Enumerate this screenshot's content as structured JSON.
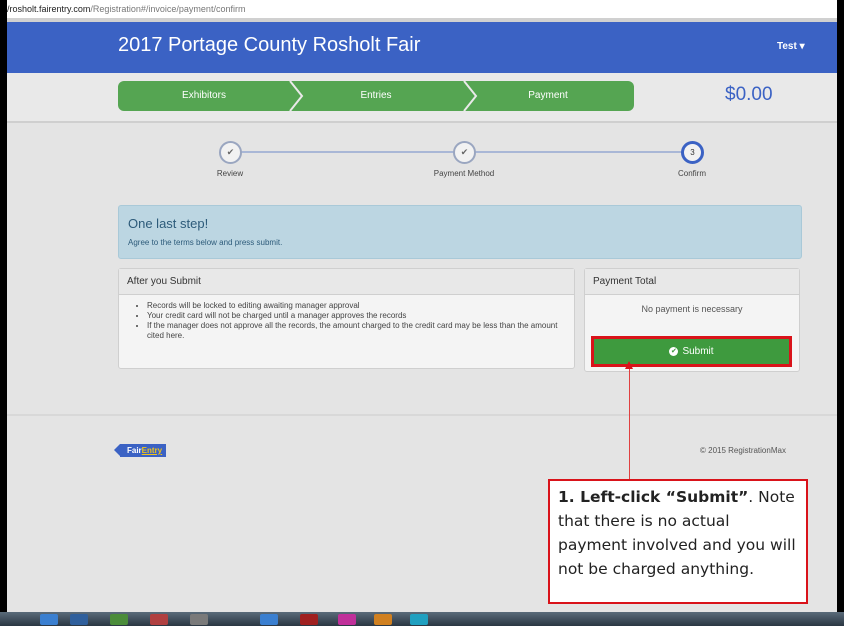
{
  "browser": {
    "url_host": "/rosholt.fairentry.com",
    "url_path": "/Registration#/invoice/payment/confirm"
  },
  "header": {
    "title": "2017 Portage County Rosholt Fair",
    "user_menu": "Test ▾"
  },
  "wizard_tabs": [
    {
      "label": "Exhibitors"
    },
    {
      "label": "Entries"
    },
    {
      "label": "Payment"
    }
  ],
  "cart_total": "$0.00",
  "progress": {
    "steps": [
      {
        "label": "Review",
        "icon": "check-icon",
        "status": "done"
      },
      {
        "label": "Payment Method",
        "icon": "check-icon",
        "status": "done"
      },
      {
        "label": "Confirm",
        "number": "3",
        "status": "active"
      }
    ]
  },
  "alert": {
    "title": "One last step!",
    "subtitle": "Agree to the terms below and press submit."
  },
  "after_submit": {
    "heading": "After you Submit",
    "items": [
      "Records will be locked to editing awaiting manager approval",
      "Your credit card will not be charged until a manager approves the records",
      "If the manager does not approve all the records, the amount charged to the credit card may be less than the amount cited here."
    ]
  },
  "payment_total": {
    "heading": "Payment Total",
    "message": "No payment is necessary",
    "submit_label": "Submit"
  },
  "footer": {
    "logo_fair": "Fair",
    "logo_entry": "Entry",
    "copyright": "© 2015 RegistrationMax"
  },
  "callout": {
    "bold": "1. Left-click “Submit”",
    "rest": ". Note that there is no actual payment involved and you will not be charged anything."
  },
  "colors": {
    "navbar": "#3b62c4",
    "wizard_green": "#55a552",
    "submit_green": "#3e9a3e",
    "highlight_red": "#d9131a",
    "alert_bg": "#bcd6e2"
  }
}
